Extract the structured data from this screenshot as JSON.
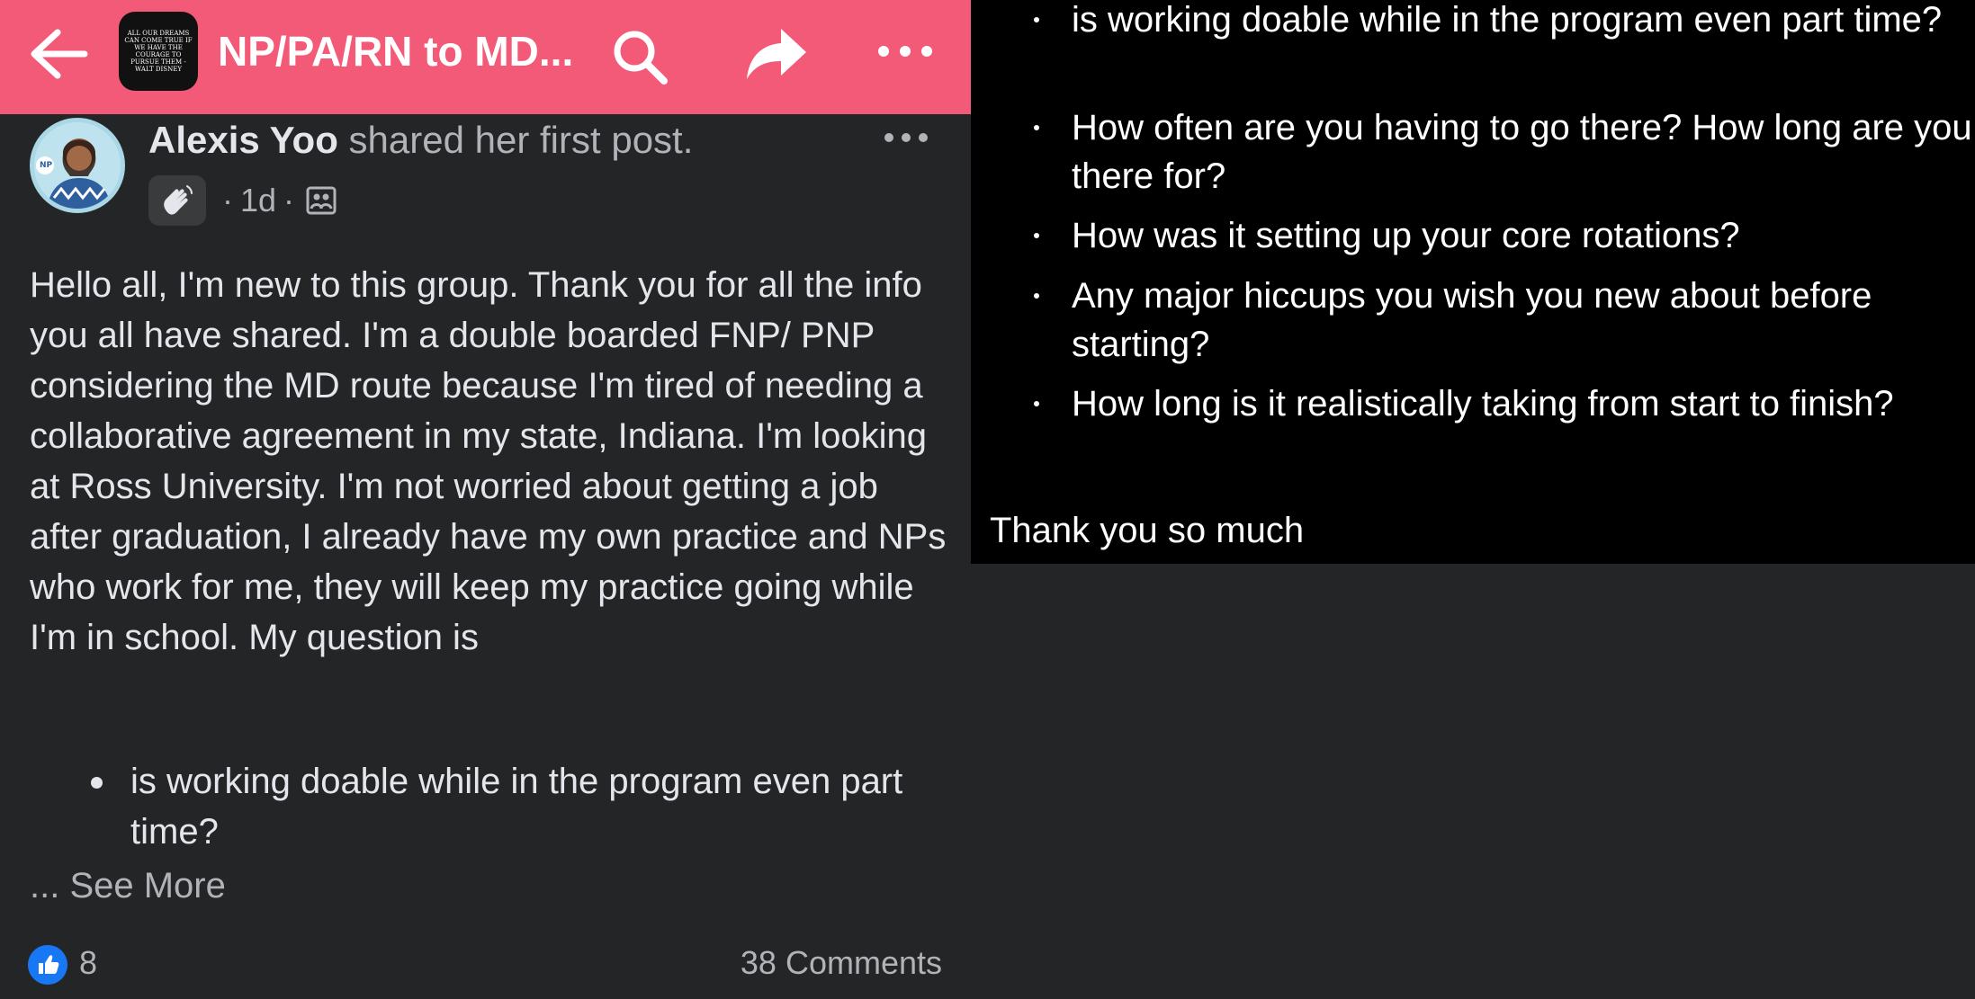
{
  "header": {
    "group_name": "NP/PA/RN to MD...",
    "group_avatar_text": "ALL OUR DREAMS CAN COME TRUE IF WE HAVE THE COURAGE TO PURSUE THEM - WALT DISNEY",
    "icons": [
      "back-arrow-icon",
      "search-icon",
      "share-icon",
      "more-icon"
    ],
    "bar_color": "#f25a77"
  },
  "post": {
    "author": "Alexis Yoo",
    "action": "shared her first post.",
    "badge_icon": "wave-hand-icon",
    "time": "1d",
    "separator": "·",
    "privacy_icon": "group-post-icon",
    "body": "Hello all, I'm new to this group. Thank you for all the info you all have shared. I'm a double boarded FNP/ PNP considering the MD route because I'm tired of needing a collaborative agreement in my state, Indiana. I'm looking at Ross University. I'm not worried about getting a job after graduation, I already have my own practice and NPs who work for me, they will keep my practice going while I'm in school. My question is",
    "list_preview": [
      "is working doable while in the program even part time?"
    ],
    "see_more": "... See More",
    "like_count": "8",
    "comments": "38 Comments"
  },
  "expanded": {
    "questions": [
      "is working doable while in the program even part time?",
      "How often are you having to go there? How long are you there for?",
      "How was it setting up your core rotations?",
      "Any major hiccups you wish you new about before starting?",
      "How long is it realistically taking from start to finish?"
    ],
    "closing": "Thank you so much"
  }
}
